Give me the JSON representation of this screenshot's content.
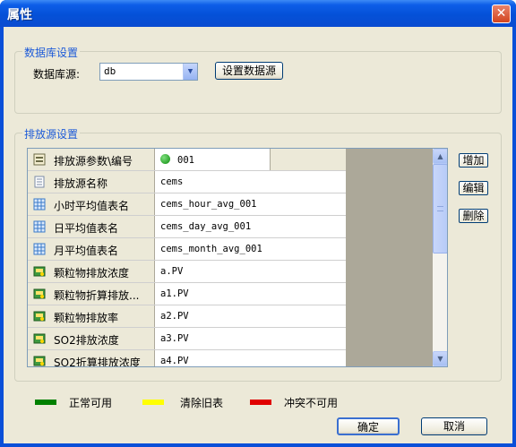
{
  "window": {
    "title": "属性",
    "close": "✕"
  },
  "db_group": {
    "title": "数据库设置",
    "source_label": "数据库源:",
    "source_value": "db",
    "setup_button": "设置数据源"
  },
  "emit_group": {
    "title": "排放源设置",
    "rows": [
      {
        "label": "排放源参数\\编号",
        "value": "001",
        "icon": "table-icon"
      },
      {
        "label": "排放源名称",
        "value": "cems",
        "icon": "document-icon"
      },
      {
        "label": "小时平均值表名",
        "value": "cems_hour_avg_001",
        "icon": "grid-icon"
      },
      {
        "label": "日平均值表名",
        "value": "cems_day_avg_001",
        "icon": "grid-icon"
      },
      {
        "label": "月平均值表名",
        "value": "cems_month_avg_001",
        "icon": "grid-icon"
      },
      {
        "label": "颗粒物排放浓度",
        "value": "a.PV",
        "icon": "sensor-icon"
      },
      {
        "label": "颗粒物折算排放...",
        "value": "a1.PV",
        "icon": "sensor-icon"
      },
      {
        "label": "颗粒物排放率",
        "value": "a2.PV",
        "icon": "sensor-icon"
      },
      {
        "label": "SO2排放浓度",
        "value": "a3.PV",
        "icon": "sensor-icon"
      },
      {
        "label": "SO2折算排放浓度",
        "value": "a4.PV",
        "icon": "sensor-icon"
      }
    ],
    "add": "增加",
    "edit": "编辑",
    "delete": "删除"
  },
  "legend": [
    {
      "label": "正常可用",
      "color": "#008000"
    },
    {
      "label": "清除旧表",
      "color": "#ffff00"
    },
    {
      "label": "冲突不可用",
      "color": "#e00000"
    }
  ],
  "footer": {
    "ok": "确定",
    "cancel": "取消"
  }
}
